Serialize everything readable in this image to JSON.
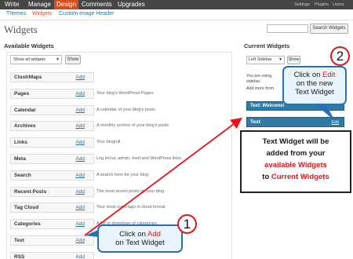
{
  "topnav": {
    "items": [
      "Write",
      "Manage",
      "Design",
      "Comments",
      "Upgrades"
    ],
    "right": [
      "Settings",
      "Plugins",
      "Users"
    ]
  },
  "subnav": [
    "Themes",
    "Widgets",
    "Custom Image Header"
  ],
  "page_title": "Widgets",
  "search_button": "Search Widgets",
  "available": {
    "heading": "Available Widgets",
    "filter_value": "Show all widgets",
    "show_label": "Show",
    "add_label": "Add",
    "widgets": [
      {
        "name": "ClustrMaps",
        "desc": ""
      },
      {
        "name": "Pages",
        "desc": "Your blog's WordPress Pages"
      },
      {
        "name": "Calendar",
        "desc": "A calendar of your blog's posts"
      },
      {
        "name": "Archives",
        "desc": "A monthly archive of your blog's posts"
      },
      {
        "name": "Links",
        "desc": "Your blogroll"
      },
      {
        "name": "Meta",
        "desc": "Log in/out, admin, feed and WordPress links"
      },
      {
        "name": "Search",
        "desc": "A search form for your blog"
      },
      {
        "name": "Recent Posts",
        "desc": "The most recent posts on your blog"
      },
      {
        "name": "Tag Cloud",
        "desc": "Your most used tags in cloud format"
      },
      {
        "name": "Categories",
        "desc": "A list or dropdown of categories"
      },
      {
        "name": "Text",
        "desc": ""
      },
      {
        "name": "RSS",
        "desc": ""
      }
    ]
  },
  "current": {
    "heading": "Current Widgets",
    "sidebar_value": "Left Sidebar",
    "show_label": "Show",
    "text_lines": [
      "You are using",
      "sidebar.",
      "Add more from"
    ],
    "widget_welcome": "Text: Welcome!",
    "widget_text": "Text",
    "widget_text_edit": "Edit"
  },
  "annotations": {
    "callout_edit": {
      "line1_pre": "Click on ",
      "line1_red": "Edit",
      "line2": "on the new",
      "line3": "Text Widget"
    },
    "callout_add": {
      "line1_pre": "Click on ",
      "line1_red": "Add",
      "line2": "on Text Widget"
    },
    "callout_info": {
      "line1": "Text Widget will be",
      "line2": "added from your",
      "line3_red": "available Widgets",
      "line4_pre": "to ",
      "line4_red": "Current Widgets"
    },
    "num1": "1",
    "num2": "2"
  },
  "colors": {
    "accent": "#d54e21",
    "link": "#21759b",
    "widget_blue": "#2e7ca6",
    "callout_border": "#2a6fb2",
    "arrow_red": "#e0161b"
  }
}
